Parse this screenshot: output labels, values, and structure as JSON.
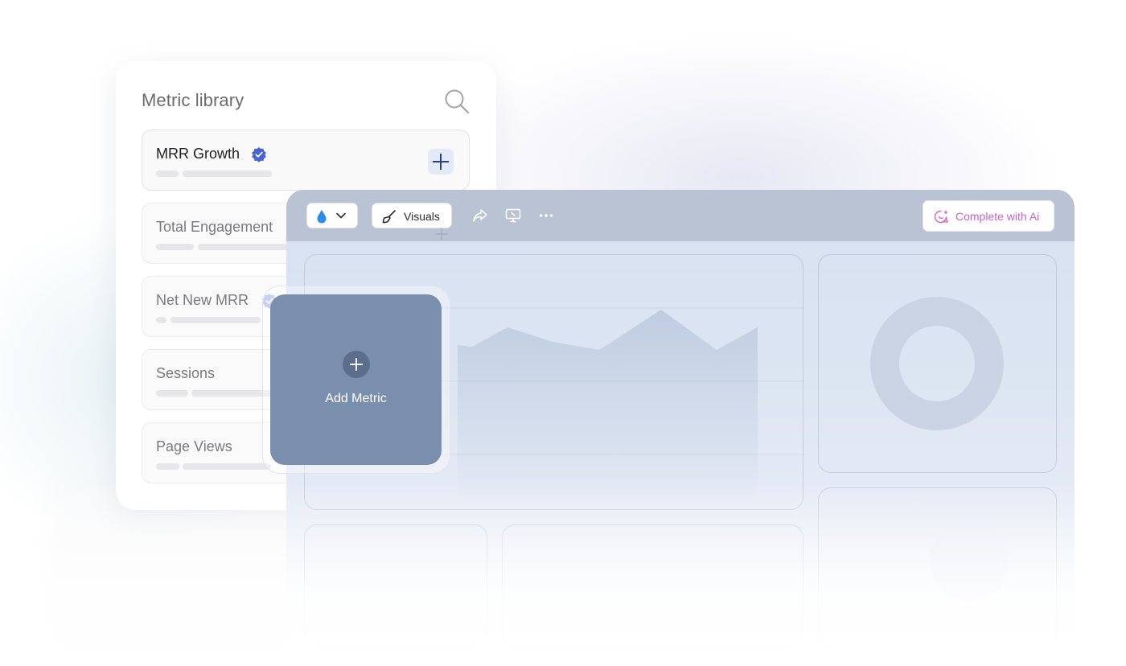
{
  "library": {
    "title": "Metric library",
    "search_icon": "search-icon",
    "metrics": [
      {
        "name": "MRR Growth",
        "verified": true,
        "active": true
      },
      {
        "name": "Total Engagement",
        "verified": false,
        "active": false
      },
      {
        "name": "Net New MRR",
        "verified": true,
        "active": false
      },
      {
        "name": "Sessions",
        "verified": false,
        "active": false
      },
      {
        "name": "Page Views",
        "verified": false,
        "active": false
      }
    ]
  },
  "toolbar": {
    "color_icon": "droplet-icon",
    "visuals_label": "Visuals",
    "ai_label": "Complete with Ai"
  },
  "drop_card": {
    "label": "Add Metric"
  },
  "colors": {
    "accent": "#4a63d9",
    "drop_card": "#7a8eae",
    "toolbar": "#b9c3d3",
    "ai_text": "#c962c9"
  }
}
